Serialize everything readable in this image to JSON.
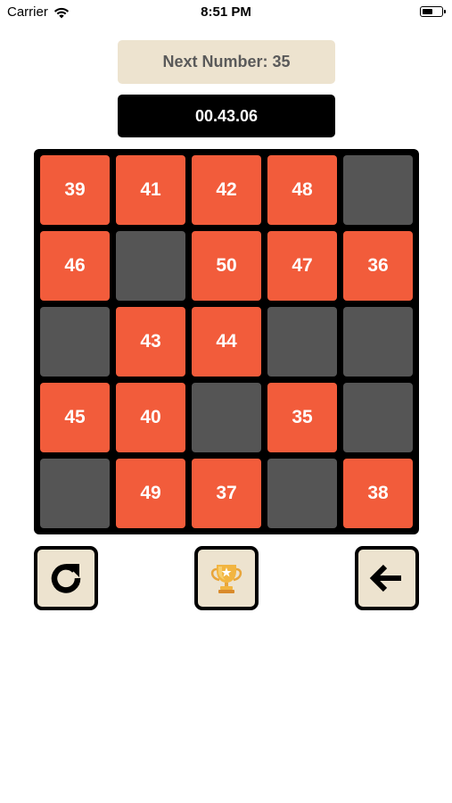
{
  "status_bar": {
    "carrier": "Carrier",
    "time": "8:51 PM",
    "battery_level": 0.55
  },
  "next_number": {
    "label": "Next Number: 35"
  },
  "timer": {
    "value": "00.43.06"
  },
  "board": {
    "rows": 5,
    "cols": 5,
    "cells": [
      [
        "39",
        "41",
        "42",
        "48",
        ""
      ],
      [
        "46",
        "",
        "50",
        "47",
        "36"
      ],
      [
        "",
        "43",
        "44",
        "",
        ""
      ],
      [
        "45",
        "40",
        "",
        "35",
        ""
      ],
      [
        "",
        "49",
        "37",
        "",
        "38"
      ]
    ],
    "colors": {
      "filled": "#f25c3b",
      "empty": "#555555",
      "frame": "#000000"
    }
  },
  "controls": {
    "restart_icon": "restart-icon",
    "trophy_icon": "trophy-icon",
    "back_icon": "back-arrow-icon"
  },
  "theme": {
    "banner_bg": "#ede3cf",
    "banner_text": "#5a5a5a",
    "timer_bg": "#000000"
  }
}
